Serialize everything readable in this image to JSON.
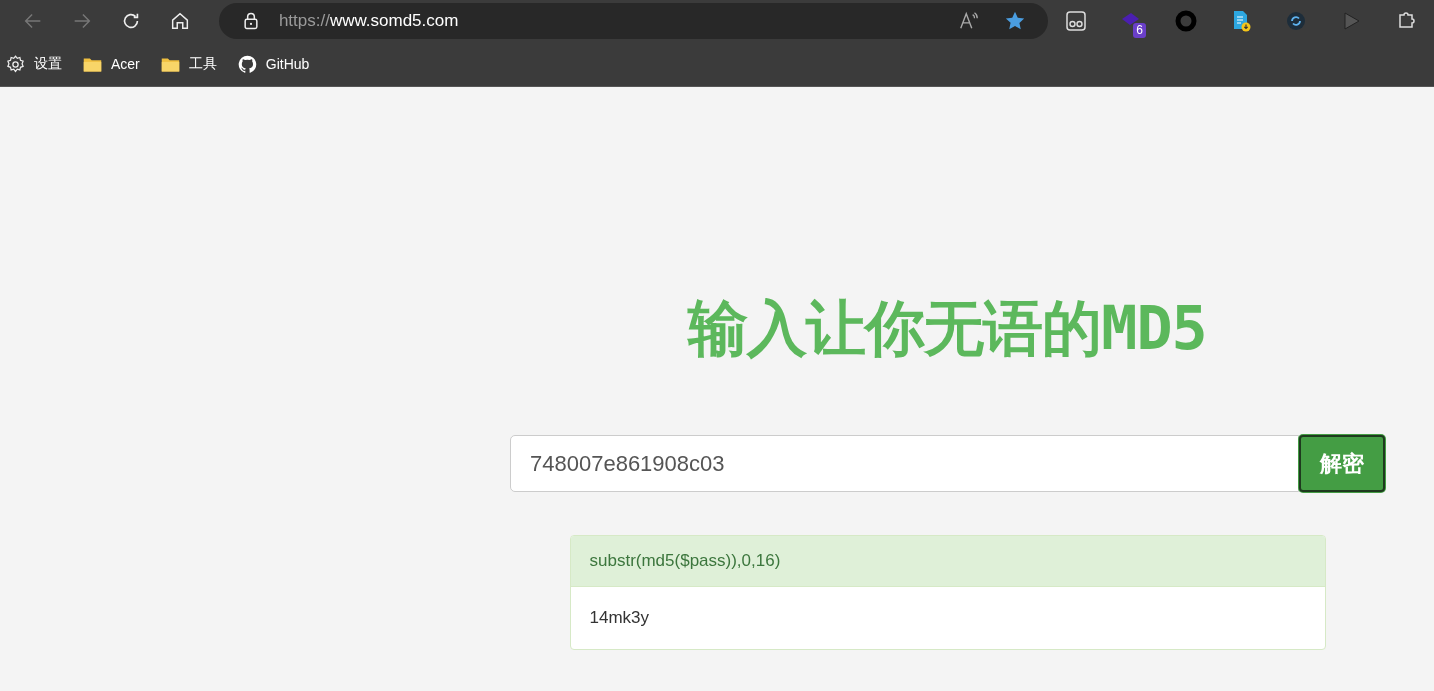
{
  "browser": {
    "address_bar": {
      "scheme": "https://",
      "host": "www.somd5.com"
    },
    "extension_badge": "6",
    "bookmarks": [
      {
        "kind": "settings",
        "label": "设置"
      },
      {
        "kind": "folder",
        "label": "Acer"
      },
      {
        "kind": "folder",
        "label": "工具"
      },
      {
        "kind": "github",
        "label": "GitHub"
      }
    ]
  },
  "page": {
    "heading": "输入让你无语的MD5",
    "hash_input": {
      "value": "748007e861908c03"
    },
    "decrypt_button": "解密",
    "result": {
      "header": "substr(md5($pass)),0,16)",
      "body": "14mk3y"
    }
  }
}
